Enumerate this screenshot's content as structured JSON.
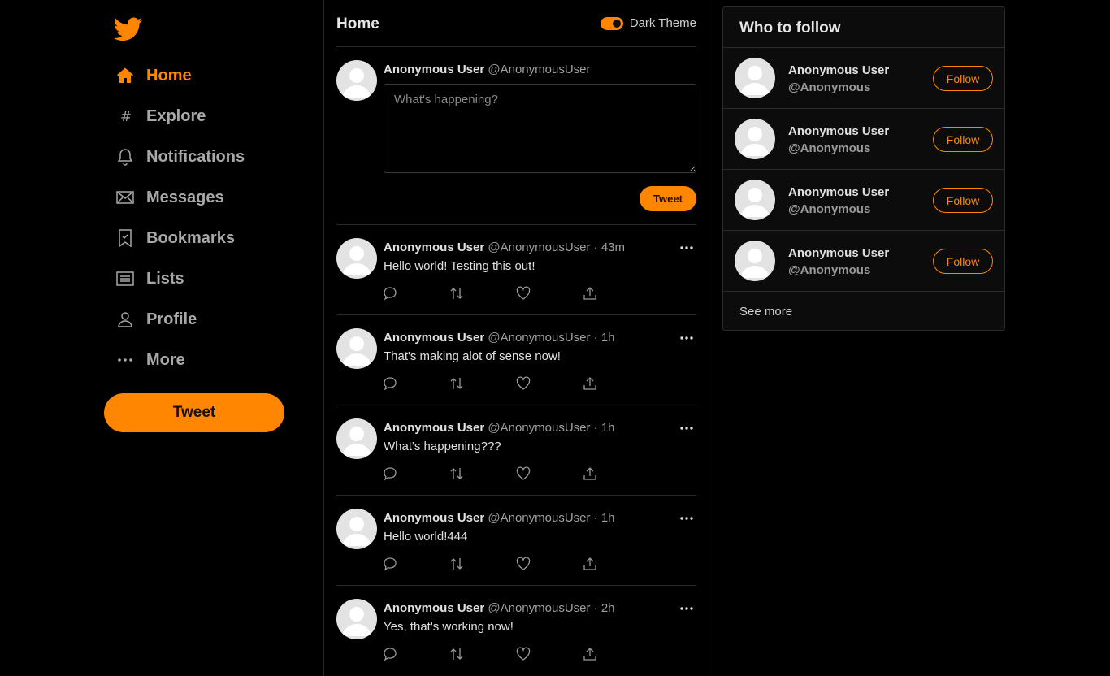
{
  "colors": {
    "accent": "#ff8600",
    "background": "#000000",
    "border": "#2a2a2a"
  },
  "sidebar": {
    "logo_icon": "bird-logo-icon",
    "items": [
      {
        "label": "Home",
        "icon": "home-icon",
        "active": true
      },
      {
        "label": "Explore",
        "icon": "hashtag-icon",
        "active": false
      },
      {
        "label": "Notifications",
        "icon": "bell-icon",
        "active": false
      },
      {
        "label": "Messages",
        "icon": "envelope-icon",
        "active": false
      },
      {
        "label": "Bookmarks",
        "icon": "bookmark-icon",
        "active": false
      },
      {
        "label": "Lists",
        "icon": "list-icon",
        "active": false
      },
      {
        "label": "Profile",
        "icon": "user-icon",
        "active": false
      },
      {
        "label": "More",
        "icon": "more-dots-icon",
        "active": false
      }
    ],
    "tweet_button": "Tweet"
  },
  "main": {
    "title": "Home",
    "theme_toggle": {
      "label": "Dark Theme",
      "on": true
    },
    "compose": {
      "name": "Anonymous User",
      "handle": "@AnonymousUser",
      "placeholder": "What's happening?",
      "button": "Tweet"
    },
    "tweets": [
      {
        "name": "Anonymous User",
        "meta": "@AnonymousUser · 43m",
        "text": "Hello world! Testing this out!"
      },
      {
        "name": "Anonymous User",
        "meta": "@AnonymousUser · 1h",
        "text": "That's making alot of sense now!"
      },
      {
        "name": "Anonymous User",
        "meta": "@AnonymousUser · 1h",
        "text": "What's happening???"
      },
      {
        "name": "Anonymous User",
        "meta": "@AnonymousUser · 1h",
        "text": "Hello world!444"
      },
      {
        "name": "Anonymous User",
        "meta": "@AnonymousUser · 2h",
        "text": "Yes, that's working now!"
      }
    ]
  },
  "who_to_follow": {
    "title": "Who to follow",
    "users": [
      {
        "name": "Anonymous User",
        "handle": "@Anonymous",
        "button": "Follow"
      },
      {
        "name": "Anonymous User",
        "handle": "@Anonymous",
        "button": "Follow"
      },
      {
        "name": "Anonymous User",
        "handle": "@Anonymous",
        "button": "Follow"
      },
      {
        "name": "Anonymous User",
        "handle": "@Anonymous",
        "button": "Follow"
      }
    ],
    "see_more": "See more"
  }
}
